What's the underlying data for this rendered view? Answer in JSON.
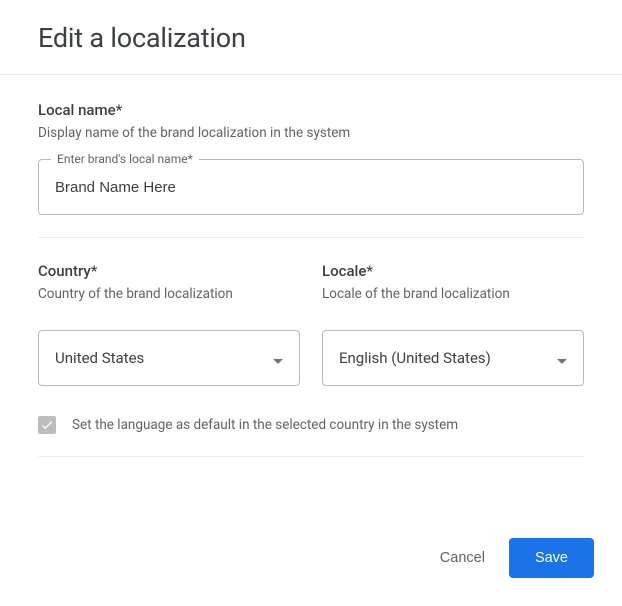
{
  "dialog": {
    "title": "Edit a localization"
  },
  "localName": {
    "label": "Local name*",
    "hint": "Display name of the brand localization in the system",
    "fieldLabel": "Enter brand's local name*",
    "value": "Brand Name Here"
  },
  "country": {
    "label": "Country*",
    "hint": "Country of the brand localization",
    "value": "United States"
  },
  "locale": {
    "label": "Locale*",
    "hint": "Locale of the brand localization",
    "value": "English (United States)"
  },
  "defaultLang": {
    "label": "Set the language as default in the selected country in the system",
    "checked": true
  },
  "actions": {
    "cancel": "Cancel",
    "save": "Save"
  }
}
